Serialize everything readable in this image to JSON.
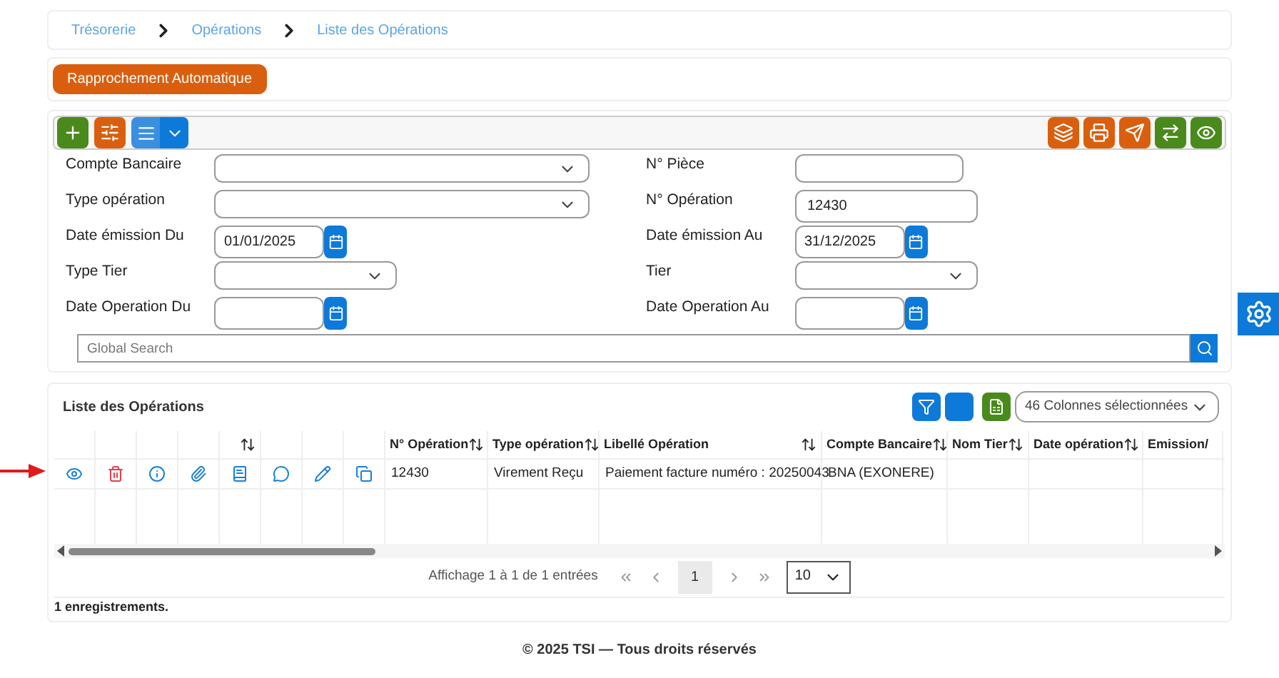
{
  "breadcrumb": [
    "Trésorerie",
    "Opérations",
    "Liste des Opérations"
  ],
  "action_button": "Rapprochement Automatique",
  "filters": [
    {
      "label": "Compte Bancaire",
      "kind": "select"
    },
    {
      "label": "N° Pièce",
      "kind": "text"
    },
    {
      "label": "Type opération",
      "kind": "select"
    },
    {
      "label": "N° Opération",
      "kind": "text",
      "value": "12430"
    },
    {
      "label": "Date émission Du",
      "kind": "date",
      "value": "01/01/2025"
    },
    {
      "label": "Date émission Au",
      "kind": "date",
      "value": "31/12/2025"
    },
    {
      "label": "Type Tier",
      "kind": "select"
    },
    {
      "label": "Tier",
      "kind": "select"
    },
    {
      "label": "Date Operation Du",
      "kind": "date"
    },
    {
      "label": "Date Operation Au",
      "kind": "date"
    }
  ],
  "global_search": {
    "placeholder": "Global Search"
  },
  "table": {
    "title": "Liste des Opérations",
    "columns_selector": "46 Colonnes sélectionnées",
    "columns": [
      {
        "kind": "action",
        "sortable": false
      },
      {
        "kind": "action",
        "sortable": false
      },
      {
        "kind": "action",
        "sortable": false
      },
      {
        "kind": "action",
        "sortable": false
      },
      {
        "kind": "action",
        "sortable": true
      },
      {
        "kind": "action",
        "sortable": false
      },
      {
        "kind": "action",
        "sortable": false
      },
      {
        "kind": "action",
        "sortable": false
      },
      {
        "kind": "data",
        "label": "N° Opération",
        "sortable": true
      },
      {
        "kind": "data",
        "label": "Type opération",
        "sortable": true
      },
      {
        "kind": "data",
        "label": "Libellé Opération",
        "sortable": true
      },
      {
        "kind": "data",
        "label": "Compte Bancaire",
        "sortable": true
      },
      {
        "kind": "data",
        "label": "Nom Tier",
        "sortable": true
      },
      {
        "kind": "data",
        "label": "Date opération",
        "sortable": true
      },
      {
        "kind": "data",
        "label": "Emission/"
      }
    ],
    "rows": [
      {
        "cells": [
          "12430",
          "Virement Reçu",
          "Paiement facture numéro : 20250043",
          "BNA (EXONERE)"
        ]
      }
    ]
  },
  "pagination": {
    "summary": "Affichage 1 à 1 de 1 entrées",
    "pages": [
      {
        "label": "1",
        "selected": true
      }
    ],
    "page_size": "10"
  },
  "record_count": "1 enregistrements.",
  "footer": "© 2025 TSI — Tous droits réservés"
}
